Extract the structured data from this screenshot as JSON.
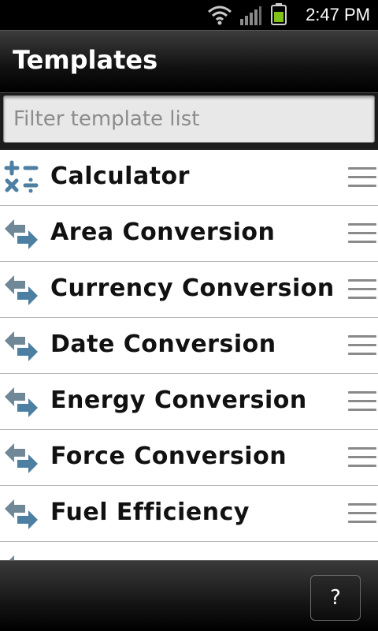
{
  "status_bar": {
    "time": "2:47 PM",
    "icons": [
      "wifi-icon",
      "signal-icon",
      "battery-icon"
    ],
    "battery_color": "#7ec21a"
  },
  "header": {
    "title": "Templates"
  },
  "filter": {
    "placeholder": "Filter template list",
    "value": ""
  },
  "templates": [
    {
      "label": "Calculator",
      "icon": "calculator-icon"
    },
    {
      "label": "Area Conversion",
      "icon": "conversion-arrows-icon"
    },
    {
      "label": "Currency Conversion",
      "icon": "conversion-arrows-icon"
    },
    {
      "label": "Date Conversion",
      "icon": "conversion-arrows-icon"
    },
    {
      "label": "Energy Conversion",
      "icon": "conversion-arrows-icon"
    },
    {
      "label": "Force Conversion",
      "icon": "conversion-arrows-icon"
    },
    {
      "label": "Fuel Efficiency",
      "icon": "conversion-arrows-icon"
    }
  ],
  "footer": {
    "help_label": "?"
  },
  "colors": {
    "icon_blue": "#4d7fa3",
    "icon_gray": "#6f8796"
  }
}
